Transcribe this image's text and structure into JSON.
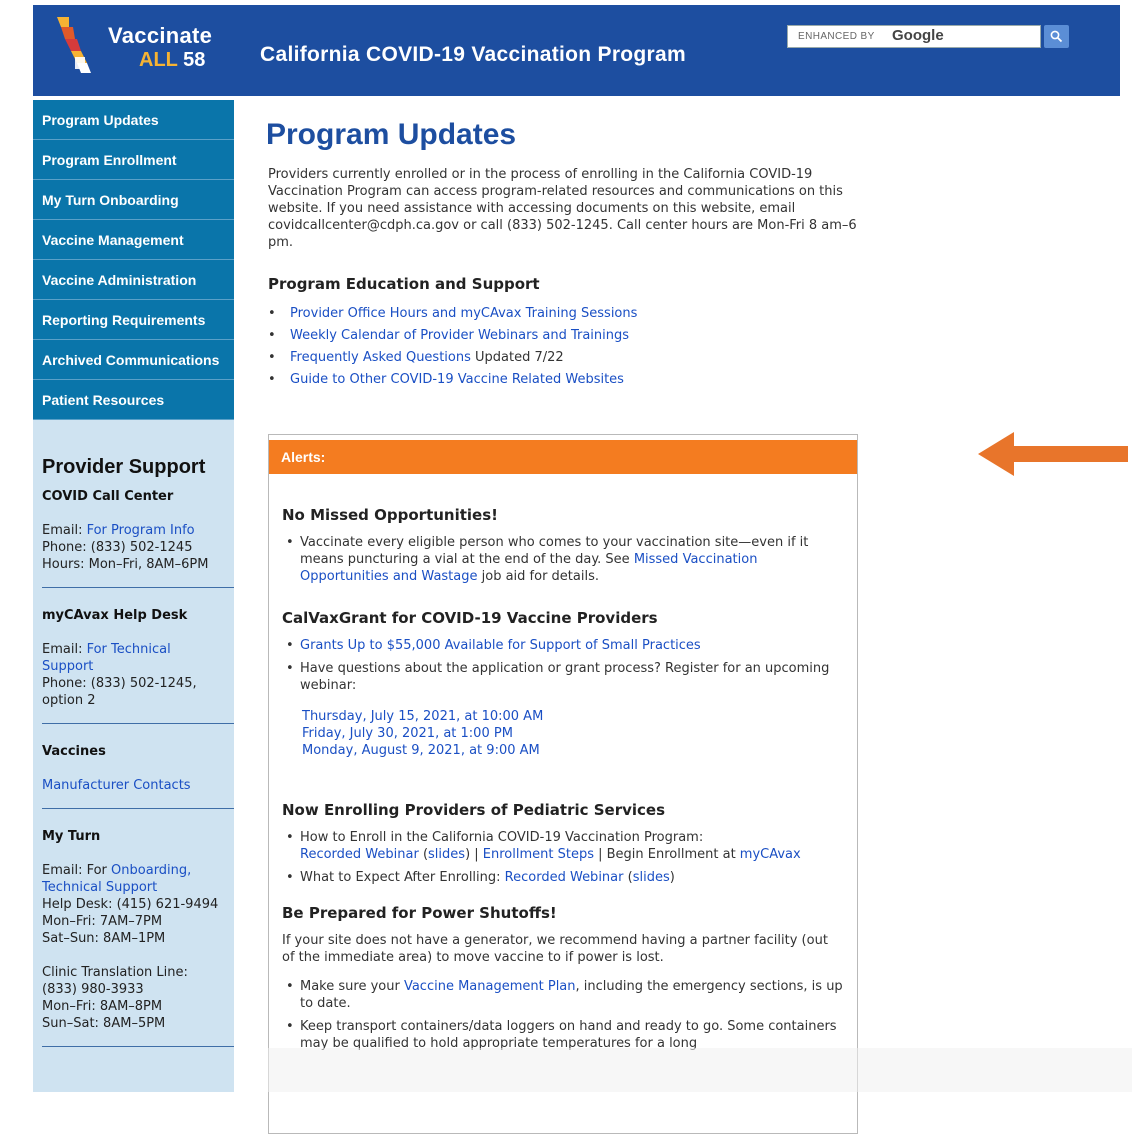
{
  "header": {
    "logo_line1": "Vaccinate",
    "logo_all": "ALL",
    "logo_num": "58",
    "title": "California COVID-19 Vaccination Program",
    "search_enhanced": "ENHANCED BY",
    "search_google": "Google"
  },
  "nav": [
    "Program Updates",
    "Program Enrollment",
    "My Turn Onboarding",
    "Vaccine Management",
    "Vaccine Administration",
    "Reporting Requirements",
    "Archived Communications",
    "Patient Resources"
  ],
  "provider_support": {
    "heading": "Provider Support",
    "call_center": {
      "title": "COVID Call Center",
      "email_label": "Email:",
      "email_link": "For Program Info",
      "phone": "Phone: (833) 502-1245",
      "hours": "Hours: Mon–Fri, 8AM–6PM"
    },
    "help_desk": {
      "title": "myCAvax Help Desk",
      "email_label": "Email:",
      "email_link": "For Technical Support",
      "phone": "Phone: (833) 502-1245,",
      "option": "option 2"
    },
    "vaccines": {
      "title": "Vaccines",
      "link": "Manufacturer Contacts"
    },
    "my_turn": {
      "title": "My Turn",
      "email_label": "Email: For",
      "link1": "Onboarding,",
      "link2": "Technical Support",
      "help": "Help Desk: (415) 621-9494",
      "wk": "Mon–Fri: 7AM–7PM",
      "we": "Sat–Sun: 8AM–1PM",
      "clinic": "Clinic Translation Line:",
      "clinic_phone": "(833) 980-3933",
      "clinic_wk": "Mon–Fri: 8AM–8PM",
      "clinic_we": "Sun–Sat: 8AM–5PM"
    }
  },
  "main": {
    "title": "Program Updates",
    "intro": "Providers currently enrolled or in the process of enrolling in the California COVID-19 Vaccination Program can access program-related resources and communications on this website. If you need assistance with accessing documents on this website, email covidcallcenter@cdph.ca.gov or call (833) 502-1245. Call center hours are Mon-Fri 8 am–6 pm.",
    "edu_title": "Program Education and Support",
    "edu_links": [
      "Provider Office Hours and myCAvax Training Sessions",
      "Weekly Calendar of Provider Webinars and Trainings",
      "Frequently Asked Questions",
      "Guide to Other COVID-19 Vaccine Related Websites"
    ],
    "faq_updated": " Updated 7/22"
  },
  "alerts": {
    "label": "Alerts:",
    "s1_title": "No Missed Opportunities!",
    "s1_text": "Vaccinate every eligible person who comes to your vaccination site—even if it means puncturing a vial at the end of the day. See ",
    "s1_link": "Missed Vaccination Opportunities and Wastage",
    "s1_tail": " job aid for details.",
    "s2_title": "CalVaxGrant for COVID-19 Vaccine Providers",
    "s2_link": "Grants Up to $55,000 Available for Support of Small Practices",
    "s2_text": "Have questions about the application or grant process? Register for an upcoming webinar:",
    "s2_dates": [
      "Thursday, July 15, 2021, at 10:00 AM",
      "Friday, July 30, 2021, at 1:00 PM",
      "Monday, August 9, 2021, at 9:00 AM"
    ],
    "s3_title": "Now Enrolling Providers of Pediatric Services",
    "s3_b1_text": "How to Enroll in the California COVID-19 Vaccination Program:",
    "s3_b1_rw": "Recorded Webinar",
    "s3_b1_slides": "slides",
    "s3_b1_steps": "Enrollment Steps",
    "s3_b1_begin": " | Begin Enrollment at ",
    "s3_b1_mycavax": "myCAvax",
    "s3_b2_text": "What to Expect After Enrolling: ",
    "s3_b2_rw": "Recorded Webinar",
    "s3_b2_slides": "slides",
    "s4_title": "Be Prepared for Power Shutoffs!",
    "s4_para": "If your site does not have a generator, we recommend having a partner facility (out of the immediate area) to move vaccine to if power is lost.",
    "s4_b1_pre": "Make sure your ",
    "s4_b1_link": "Vaccine Management Plan",
    "s4_b1_post": ", including the emergency sections, is up to date.",
    "s4_b2": "Keep transport containers/data loggers on hand and ready to go. Some containers may be qualified to hold appropriate temperatures for a long"
  },
  "colors": {
    "header_bg": "#1d4ea0",
    "nav_bg": "#0a75aa",
    "sidebar_bg": "#cfe3f1",
    "alert_orange": "#f47c20",
    "link": "#1a4fc4"
  }
}
